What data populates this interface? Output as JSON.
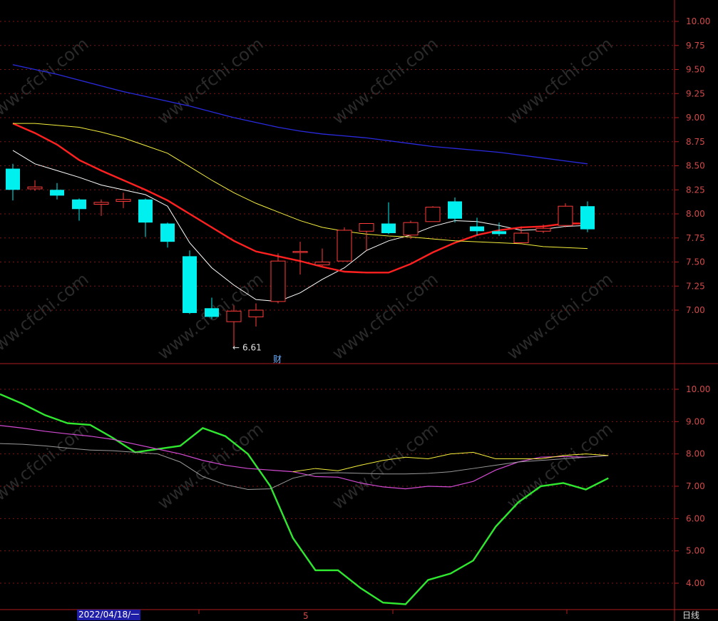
{
  "chart_data": [
    {
      "type": "candlestick",
      "ylim": [
        6.4,
        10.2
      ],
      "yticks": [
        "10.00",
        "9.75",
        "9.50",
        "9.25",
        "9.00",
        "8.75",
        "8.50",
        "8.25",
        "8.00",
        "7.75",
        "7.50",
        "7.25",
        "7.00"
      ],
      "candles": [
        {
          "o": 8.47,
          "h": 8.52,
          "l": 8.14,
          "c": 8.25
        },
        {
          "o": 8.26,
          "h": 8.35,
          "l": 8.24,
          "c": 8.28
        },
        {
          "o": 8.25,
          "h": 8.32,
          "l": 8.15,
          "c": 8.19
        },
        {
          "o": 8.15,
          "h": 8.16,
          "l": 7.93,
          "c": 8.05
        },
        {
          "o": 8.1,
          "h": 8.15,
          "l": 7.98,
          "c": 8.12
        },
        {
          "o": 8.13,
          "h": 8.22,
          "l": 8.06,
          "c": 8.15
        },
        {
          "o": 8.15,
          "h": 8.16,
          "l": 7.76,
          "c": 7.91
        },
        {
          "o": 7.9,
          "h": 7.91,
          "l": 7.65,
          "c": 7.71
        },
        {
          "o": 7.56,
          "h": 7.62,
          "l": 6.96,
          "c": 6.97
        },
        {
          "o": 7.02,
          "h": 7.13,
          "l": 6.91,
          "c": 6.93
        },
        {
          "o": 6.88,
          "h": 7.05,
          "l": 6.61,
          "c": 6.99
        },
        {
          "o": 6.93,
          "h": 7.07,
          "l": 6.83,
          "c": 7.0
        },
        {
          "o": 7.09,
          "h": 7.59,
          "l": 7.07,
          "c": 7.51
        },
        {
          "o": 7.6,
          "h": 7.71,
          "l": 7.37,
          "c": 7.61
        },
        {
          "o": 7.47,
          "h": 7.64,
          "l": 7.46,
          "c": 7.5
        },
        {
          "o": 7.51,
          "h": 7.86,
          "l": 7.51,
          "c": 7.83
        },
        {
          "o": 7.82,
          "h": 7.9,
          "l": 7.62,
          "c": 7.9
        },
        {
          "o": 7.9,
          "h": 8.12,
          "l": 7.79,
          "c": 7.8
        },
        {
          "o": 7.78,
          "h": 7.93,
          "l": 7.74,
          "c": 7.91
        },
        {
          "o": 7.92,
          "h": 8.08,
          "l": 7.92,
          "c": 8.07
        },
        {
          "o": 8.13,
          "h": 8.17,
          "l": 7.91,
          "c": 7.95
        },
        {
          "o": 7.87,
          "h": 7.96,
          "l": 7.78,
          "c": 7.82
        },
        {
          "o": 7.82,
          "h": 7.91,
          "l": 7.77,
          "c": 7.79
        },
        {
          "o": 7.7,
          "h": 7.87,
          "l": 7.7,
          "c": 7.8
        },
        {
          "o": 7.82,
          "h": 7.89,
          "l": 7.8,
          "c": 7.85
        },
        {
          "o": 7.88,
          "h": 8.11,
          "l": 7.86,
          "c": 8.08
        },
        {
          "o": 8.08,
          "h": 8.13,
          "l": 7.81,
          "c": 7.84
        }
      ],
      "series": [
        {
          "color": "#ffffff",
          "values": [
            8.66,
            8.52,
            8.45,
            8.38,
            8.3,
            8.25,
            8.2,
            8.08,
            7.7,
            7.44,
            7.26,
            7.11,
            7.09,
            7.18,
            7.32,
            7.44,
            7.62,
            7.72,
            7.78,
            7.87,
            7.93,
            7.92,
            7.88,
            7.83,
            7.84,
            7.87,
            7.88
          ]
        },
        {
          "color": "#ff2020",
          "values": [
            8.94,
            8.84,
            8.72,
            8.56,
            8.45,
            8.35,
            8.25,
            8.14,
            8.0,
            7.86,
            7.72,
            7.61,
            7.56,
            7.51,
            7.45,
            7.4,
            7.39,
            7.39,
            7.48,
            7.6,
            7.7,
            7.78,
            7.83,
            7.86,
            7.87,
            7.9,
            7.9
          ]
        },
        {
          "color": "#f5ef3a",
          "values": [
            8.94,
            8.94,
            8.92,
            8.9,
            8.85,
            8.79,
            8.71,
            8.63,
            8.49,
            8.35,
            8.22,
            8.11,
            8.02,
            7.93,
            7.86,
            7.82,
            7.79,
            7.77,
            7.76,
            7.74,
            7.72,
            7.71,
            7.7,
            7.69,
            7.66,
            7.65,
            7.64
          ]
        },
        {
          "color": "#2a2ae0",
          "values": [
            9.55,
            9.5,
            9.45,
            9.39,
            9.33,
            9.27,
            9.22,
            9.17,
            9.12,
            9.06,
            9.0,
            8.95,
            8.9,
            8.86,
            8.83,
            8.81,
            8.79,
            8.76,
            8.73,
            8.7,
            8.68,
            8.66,
            8.64,
            8.61,
            8.58,
            8.55,
            8.52
          ]
        }
      ],
      "annotations": [
        {
          "text": "6.61",
          "candle": 10
        },
        {
          "text": "财",
          "candle": 12
        }
      ]
    },
    {
      "type": "line",
      "ylim": [
        3.2,
        10.9
      ],
      "yticks": [
        "10.00",
        "9.00",
        "8.00",
        "7.00",
        "6.00",
        "5.00",
        "4.00"
      ],
      "series": [
        {
          "color": "#2fe82f",
          "values": [
            9.85,
            9.55,
            9.2,
            8.95,
            8.9,
            8.5,
            8.05,
            8.15,
            8.25,
            8.8,
            8.55,
            8.0,
            7.0,
            5.4,
            4.4,
            4.4,
            3.85,
            3.4,
            3.35,
            4.1,
            4.3,
            4.7,
            5.75,
            6.5,
            7.0,
            7.1,
            6.9,
            7.25
          ]
        },
        {
          "color": "#d24ad2",
          "values": [
            8.88,
            8.8,
            8.7,
            8.62,
            8.55,
            8.45,
            8.3,
            8.15,
            8.0,
            7.8,
            7.65,
            7.55,
            7.5,
            7.45,
            7.3,
            7.28,
            7.1,
            6.98,
            6.92,
            7.0,
            6.98,
            7.15,
            7.5,
            7.75,
            7.9,
            7.92,
            7.9,
            7.95
          ]
        },
        {
          "color": "#9a9a9a",
          "values": [
            8.32,
            8.3,
            8.25,
            8.18,
            8.12,
            8.1,
            8.05,
            8.0,
            7.75,
            7.3,
            7.05,
            6.9,
            6.92,
            7.25,
            7.4,
            7.42,
            7.4,
            7.38,
            7.38,
            7.4,
            7.45,
            7.55,
            7.65,
            7.75,
            7.8,
            7.85,
            7.9,
            7.95
          ]
        },
        {
          "color": "#f5ef3a",
          "values": [
            null,
            null,
            null,
            null,
            null,
            null,
            null,
            null,
            null,
            null,
            null,
            null,
            null,
            7.45,
            7.55,
            7.48,
            7.65,
            7.8,
            7.9,
            7.85,
            8.0,
            8.05,
            7.85,
            7.85,
            7.85,
            7.95,
            8.0,
            7.95
          ]
        }
      ]
    }
  ],
  "bottom_bar": {
    "date_label": "2022/04/18/一",
    "marker_label": "5",
    "period_label": "日线"
  },
  "watermark": "www.cfchi.com",
  "colors": {
    "up": "#ff3b3b",
    "down": "#00f0f0",
    "grid": "#7a1616",
    "axis": "#b01c1c",
    "tick_text": "#d24a4a"
  }
}
